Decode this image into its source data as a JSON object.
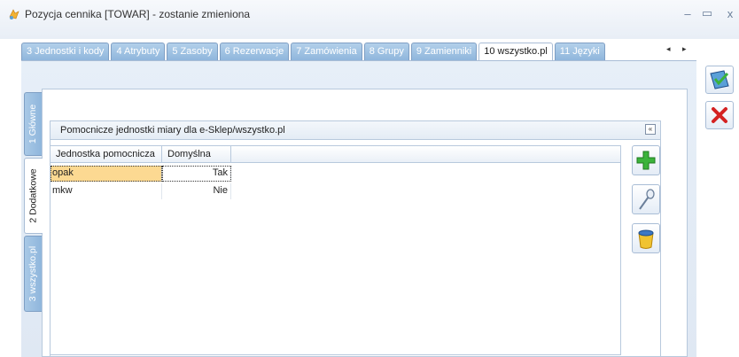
{
  "window": {
    "title": "Pozycja cennika [TOWAR] - zostanie zmieniona",
    "minimize": "–",
    "maximize": "▭",
    "close": "x"
  },
  "tabs": [
    {
      "label": "3 Jednostki i kody",
      "active": false
    },
    {
      "label": "4 Atrybuty",
      "active": false
    },
    {
      "label": "5 Zasoby",
      "active": false
    },
    {
      "label": "6 Rezerwacje",
      "active": false
    },
    {
      "label": "7 Zamówienia",
      "active": false
    },
    {
      "label": "8 Grupy",
      "active": false
    },
    {
      "label": "9 Zamienniki",
      "active": false
    },
    {
      "label": "10 wszystko.pl",
      "active": true
    },
    {
      "label": "11 Języki",
      "active": false
    }
  ],
  "tab_nav": {
    "prev": "◂",
    "next": "▸"
  },
  "vertical_tabs": [
    {
      "label": "1 Główne",
      "active": false
    },
    {
      "label": "2 Dodatkowe",
      "active": true
    },
    {
      "label": "3 wszystko.pl",
      "active": false
    }
  ],
  "group": {
    "title": "Pomocnicze jednostki miary dla e-Sklep/wszystko.pl",
    "collapse_glyph": "«"
  },
  "grid": {
    "columns": [
      "Jednostka pomocnicza",
      "Domyślna"
    ],
    "rows": [
      {
        "unit": "opak",
        "default": "Tak",
        "selected": true
      },
      {
        "unit": "mkw",
        "default": "Nie",
        "selected": false
      }
    ]
  },
  "icons": {
    "save": "save-icon",
    "cancel": "cancel-icon",
    "add": "plus-icon",
    "edit": "edit-icon",
    "delete": "trash-icon"
  },
  "colors": {
    "tab_blue": "#8fb6dc",
    "selection": "#fcd992",
    "add_green": "#3bb33b",
    "cancel_red": "#d42222"
  }
}
